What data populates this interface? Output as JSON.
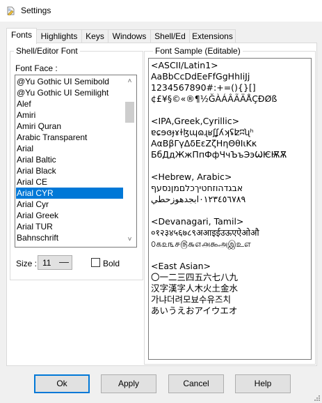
{
  "window": {
    "title": "Settings"
  },
  "tabs": [
    "Fonts",
    "Highlights",
    "Keys",
    "Windows",
    "Shell/Ed",
    "Extensions"
  ],
  "shell_font_group": {
    "title": "Shell/Editor Font",
    "font_face_label": "Font Face :",
    "fonts": [
      "@Yu Gothic UI Semibold",
      "@Yu Gothic UI Semilight",
      "Alef",
      "Amiri",
      "Amiri Quran",
      "Arabic Transparent",
      "Arial",
      "Arial Baltic",
      "Arial Black",
      "Arial CE",
      "Arial CYR",
      "Arial Cyr",
      "Arial Greek",
      "Arial TUR",
      "Bahnschrift"
    ],
    "selected_font": "Arial CYR",
    "size_label": "Size :",
    "size_value": "11",
    "bold_label": "Bold",
    "bold_checked": false
  },
  "sample_group": {
    "title": "Font Sample (Editable)",
    "lines": [
      "<ASCII/Latin1>",
      "AaBbCcDdEeFfGgHhIiJj",
      "1234567890#:+=(){}[]",
      "¢£¥§©«®¶½ĞÀÁÂÃÄÅÇÐØß",
      "",
      "<IPA,Greek,Cyrillic>",
      "ɐɕɘɞɟɤɫɮɰɷɻʁʃʆʎʞʢʫʭʯʰ",
      "ΑαΒβΓγΔδΕεΖζΗηΘθΙιΚκ",
      "БбДдЖжПпФфЧчЪъЭэѠѤѬѪ",
      "",
      "<Hebrew, Arabic>",
      "אבגדהוזחטיךכלםמןנסעף",
      "٠١٢٣٤٥٦٧٨٩ابجدهوزحطي",
      "",
      "<Devanagari, Tamil>",
      "०१२३४५६७८९अआइईउऊएऐओऔ",
      "௦௧௨௩௪௫௬௭௮௯அஇஉஎ",
      "",
      "<East Asian>",
      "〇一二三四五六七八九",
      "汉字漢字人木火土金水",
      "가냐더려모뵤수유즈치",
      "あいうえおアイウエオ"
    ]
  },
  "buttons": {
    "ok": "Ok",
    "apply": "Apply",
    "cancel": "Cancel",
    "help": "Help"
  },
  "colors": {
    "selection": "#0078d7",
    "window_bg": "#f0f0f0"
  }
}
